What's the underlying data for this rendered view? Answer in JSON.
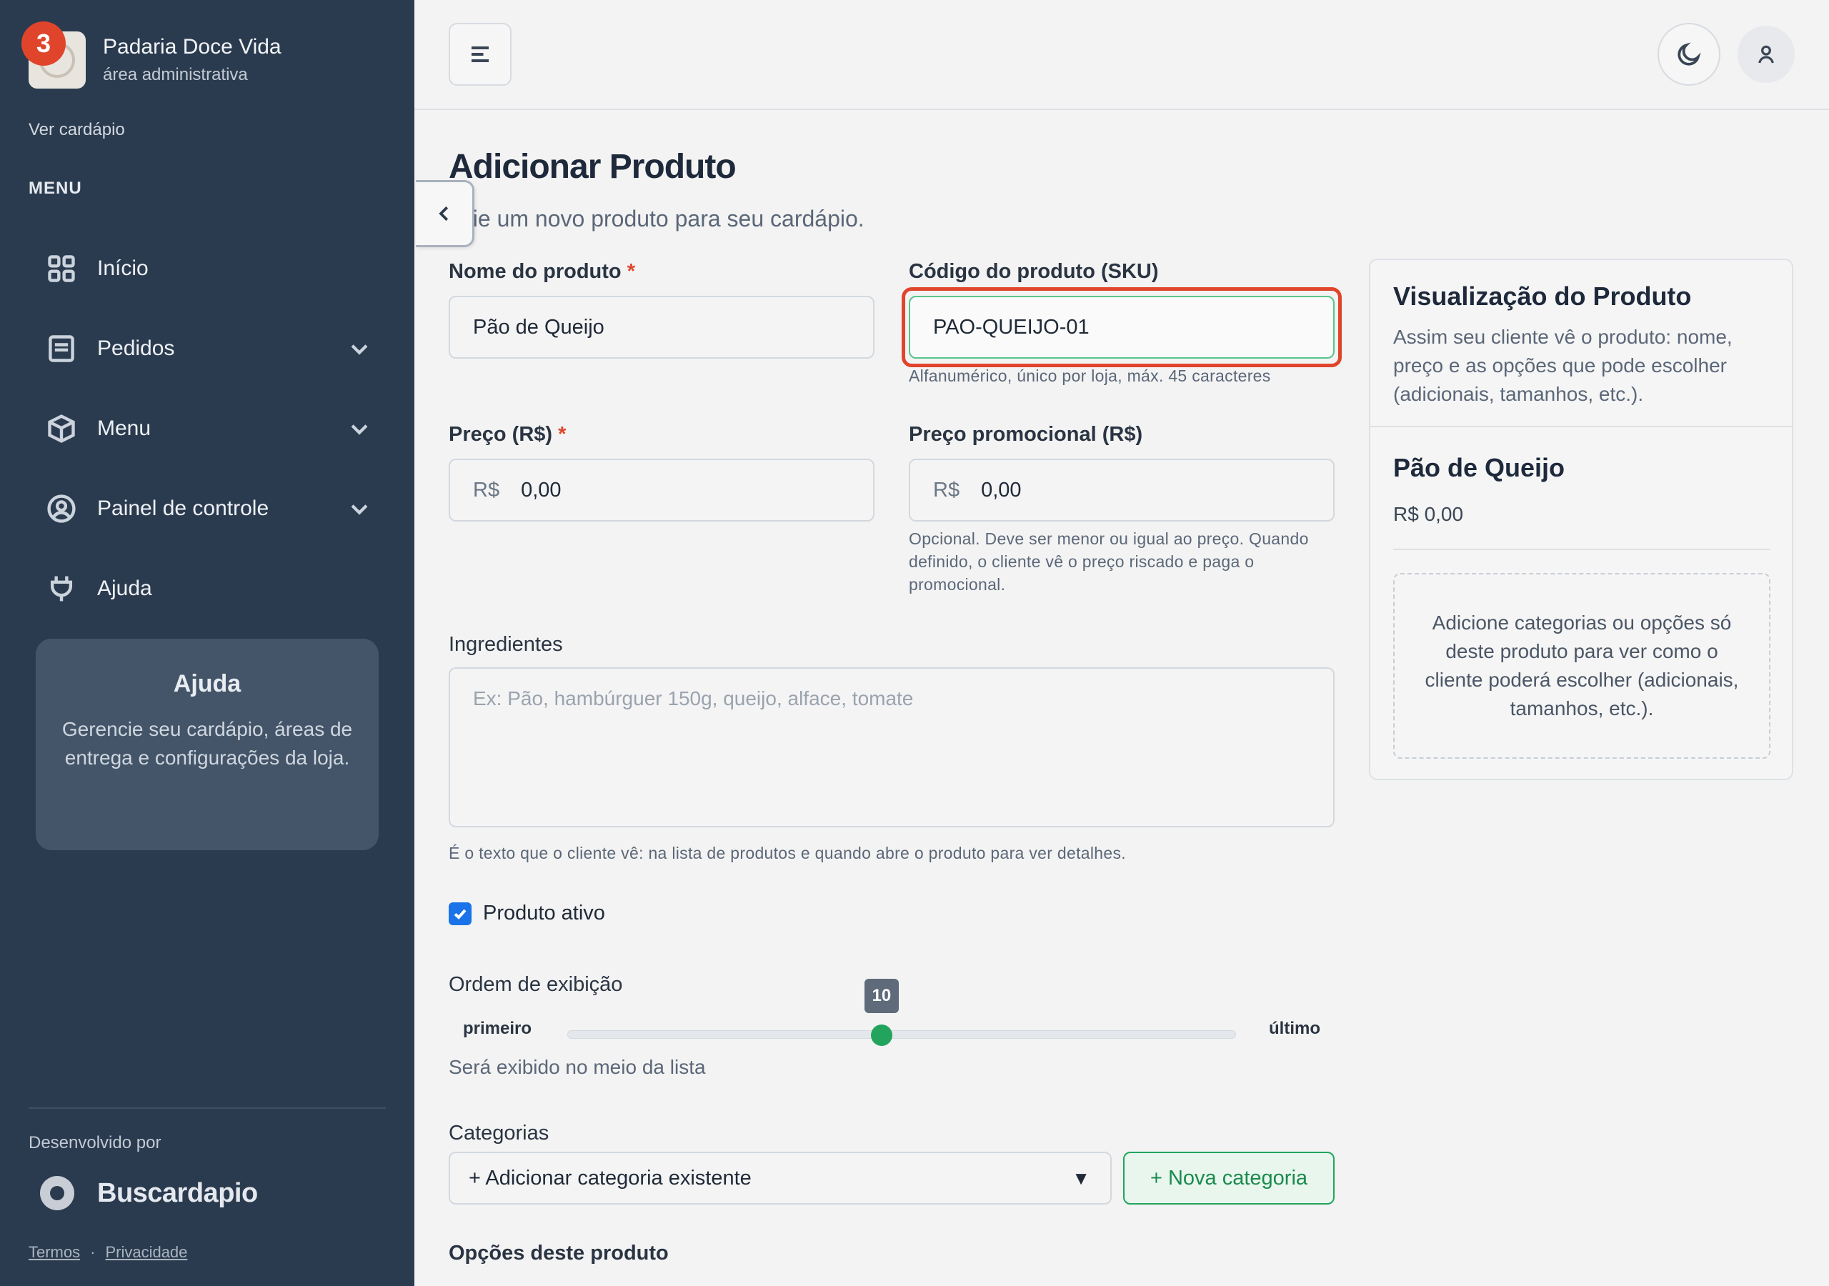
{
  "sidebar": {
    "notification_count": "3",
    "brand_name": "Padaria Doce Vida",
    "brand_sub": "área administrativa",
    "ver_cardapio": "Ver cardápio",
    "menu_heading": "MENU",
    "items": [
      {
        "label": "Início",
        "icon": "grid-icon",
        "has_chevron": false
      },
      {
        "label": "Pedidos",
        "icon": "receipt-icon",
        "has_chevron": true
      },
      {
        "label": "Menu",
        "icon": "box-icon",
        "has_chevron": true
      },
      {
        "label": "Painel de controle",
        "icon": "user-circle-icon",
        "has_chevron": true
      },
      {
        "label": "Ajuda",
        "icon": "plug-icon",
        "has_chevron": false
      }
    ],
    "help": {
      "title": "Ajuda",
      "text": "Gerencie seu cardápio, áreas de entrega e configurações da loja."
    },
    "dev_by": "Desenvolvido por",
    "dev_name": "Buscardapio",
    "terms": "Termos",
    "separator": "·",
    "privacy": "Privacidade"
  },
  "page": {
    "title": "Adicionar Produto",
    "subtitle": "Crie um novo produto para seu cardápio."
  },
  "form": {
    "name_label": "Nome do produto",
    "name_value": "Pão de Queijo",
    "sku_label": "Código do produto (SKU)",
    "sku_value": "PAO-QUEIJO-01",
    "sku_hint": "Alfanumérico, único por loja, máx. 45 caracteres",
    "price_label": "Preço (R$)",
    "price_prefix": "R$",
    "price_value": "0,00",
    "promo_label": "Preço promocional (R$)",
    "promo_prefix": "R$",
    "promo_value": "0,00",
    "promo_hint": "Opcional. Deve ser menor ou igual ao preço. Quando definido, o cliente vê o preço riscado e paga o promocional.",
    "required_mark": "*",
    "ingredients_label": "Ingredientes",
    "ingredients_placeholder": "Ex: Pão, hambúrguer 150g, queijo, alface, tomate",
    "ingredients_hint": "É o texto que o cliente vê: na lista de produtos e quando abre o produto para ver detalhes.",
    "active_label": "Produto ativo",
    "active_checked": true,
    "order_label": "Ordem de exibição",
    "order_value": "10",
    "order_fraction": 0.47,
    "order_min_label": "primeiro",
    "order_max_label": "último",
    "order_note": "Será exibido no meio da lista",
    "categories_label": "Categorias",
    "categories_select": "+ Adicionar categoria existente",
    "categories_caret": "▼",
    "new_category": "+ Nova categoria",
    "options_label": "Opções deste produto"
  },
  "preview": {
    "title": "Visualização do Produto",
    "description": "Assim seu cliente vê o produto: nome, preço e as opções que pode escolher (adicionais, tamanhos, etc.).",
    "product_name": "Pão de Queijo",
    "product_price": "R$ 0,00",
    "empty_text": "Adicione categorias ou opções só deste produto para ver como o cliente poderá escolher (adicionais, tamanhos, etc.)."
  },
  "colors": {
    "sidebar_bg": "#2b3b4f",
    "accent_green": "#22a45d",
    "highlight_red": "#e0452b",
    "checkbox_blue": "#1a73e8"
  }
}
